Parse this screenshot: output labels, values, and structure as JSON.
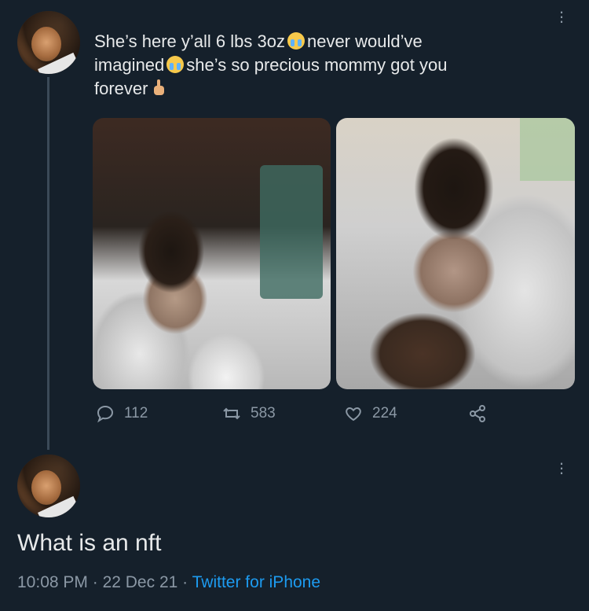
{
  "tweet": {
    "text_line1a": "She’s here y’all 6 lbs  3oz",
    "text_line1b": "never would’ve",
    "text_line2a": "imagined",
    "text_line2b": "she’s so precious mommy got you",
    "text_line3": "forever",
    "emojis": [
      "loudly-crying-face",
      "loudly-crying-face",
      "crossed-fingers"
    ],
    "actions": {
      "reply_count": "112",
      "retweet_count": "583",
      "like_count": "224"
    }
  },
  "reply": {
    "text": "What is an nft",
    "time": "10:08 PM",
    "separator": "·",
    "date": "22 Dec 21",
    "source": "Twitter for iPhone"
  },
  "colors": {
    "background": "#15202b",
    "text": "#e7e9ea",
    "muted": "#8b98a5",
    "link": "#1d9bf0"
  }
}
